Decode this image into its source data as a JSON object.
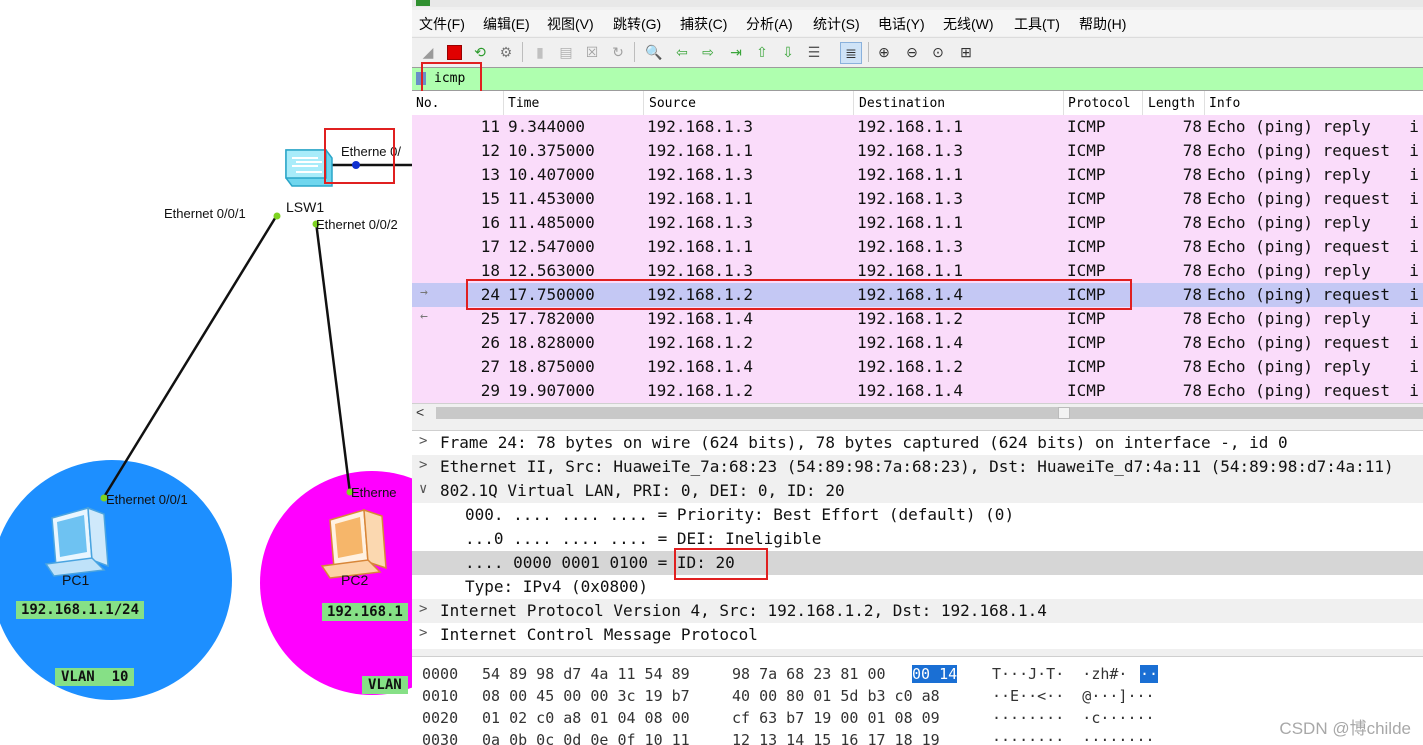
{
  "topology": {
    "switch_label": "LSW1",
    "port_e001": "Ethernet 0/0/1",
    "port_e002": "Ethernet 0/0/2",
    "port_uplink": "Etherne",
    "port_uplink_cut": "0/",
    "pc1": {
      "name": "PC1",
      "port": "Ethernet 0/0/1",
      "ip": "192.168.1.1/24",
      "vlan": "VLAN  10"
    },
    "pc2": {
      "name": "PC2",
      "port": "Etherne",
      "ip": "192.168.1",
      "vlan": "VLAN"
    },
    "colors": {
      "pc1_circle": "#1d8fff",
      "pc2_circle": "#ff00ff",
      "badge": "#86e086",
      "highlight_box": "#e02020"
    }
  },
  "wireshark": {
    "menu": [
      "文件(F)",
      "编辑(E)",
      "视图(V)",
      "跳转(G)",
      "捕获(C)",
      "分析(A)",
      "统计(S)",
      "电话(Y)",
      "无线(W)",
      "工具(T)",
      "帮助(H)"
    ],
    "filter": {
      "value": "icmp"
    },
    "columns": [
      "No.",
      "Time",
      "Source",
      "Destination",
      "Protocol",
      "Length",
      "Info"
    ],
    "packets": [
      {
        "no": "11",
        "time": "9.344000",
        "src": "192.168.1.3",
        "dst": "192.168.1.1",
        "proto": "ICMP",
        "len": "78",
        "info": "Echo (ping) reply    i"
      },
      {
        "no": "12",
        "time": "10.375000",
        "src": "192.168.1.1",
        "dst": "192.168.1.3",
        "proto": "ICMP",
        "len": "78",
        "info": "Echo (ping) request  i"
      },
      {
        "no": "13",
        "time": "10.407000",
        "src": "192.168.1.3",
        "dst": "192.168.1.1",
        "proto": "ICMP",
        "len": "78",
        "info": "Echo (ping) reply    i"
      },
      {
        "no": "15",
        "time": "11.453000",
        "src": "192.168.1.1",
        "dst": "192.168.1.3",
        "proto": "ICMP",
        "len": "78",
        "info": "Echo (ping) request  i"
      },
      {
        "no": "16",
        "time": "11.485000",
        "src": "192.168.1.3",
        "dst": "192.168.1.1",
        "proto": "ICMP",
        "len": "78",
        "info": "Echo (ping) reply    i"
      },
      {
        "no": "17",
        "time": "12.547000",
        "src": "192.168.1.1",
        "dst": "192.168.1.3",
        "proto": "ICMP",
        "len": "78",
        "info": "Echo (ping) request  i"
      },
      {
        "no": "18",
        "time": "12.563000",
        "src": "192.168.1.3",
        "dst": "192.168.1.1",
        "proto": "ICMP",
        "len": "78",
        "info": "Echo (ping) reply    i"
      },
      {
        "no": "24",
        "time": "17.750000",
        "src": "192.168.1.2",
        "dst": "192.168.1.4",
        "proto": "ICMP",
        "len": "78",
        "info": "Echo (ping) request  i"
      },
      {
        "no": "25",
        "time": "17.782000",
        "src": "192.168.1.4",
        "dst": "192.168.1.2",
        "proto": "ICMP",
        "len": "78",
        "info": "Echo (ping) reply    i"
      },
      {
        "no": "26",
        "time": "18.828000",
        "src": "192.168.1.2",
        "dst": "192.168.1.4",
        "proto": "ICMP",
        "len": "78",
        "info": "Echo (ping) request  i"
      },
      {
        "no": "27",
        "time": "18.875000",
        "src": "192.168.1.4",
        "dst": "192.168.1.2",
        "proto": "ICMP",
        "len": "78",
        "info": "Echo (ping) reply    i"
      },
      {
        "no": "29",
        "time": "19.907000",
        "src": "192.168.1.2",
        "dst": "192.168.1.4",
        "proto": "ICMP",
        "len": "78",
        "info": "Echo (ping) request  i"
      }
    ],
    "selected_no": "24",
    "details": [
      {
        "arrow": ">",
        "indent": 0,
        "text": "Frame 24: 78 bytes on wire (624 bits), 78 bytes captured (624 bits) on interface -, id 0"
      },
      {
        "arrow": ">",
        "indent": 0,
        "text": "Ethernet II, Src: HuaweiTe_7a:68:23 (54:89:98:7a:68:23), Dst: HuaweiTe_d7:4a:11 (54:89:98:d7:4a:11)"
      },
      {
        "arrow": "∨",
        "indent": 0,
        "text": "802.1Q Virtual LAN, PRI: 0, DEI: 0, ID: 20"
      },
      {
        "arrow": "",
        "indent": 1,
        "text": "000. .... .... .... = Priority: Best Effort (default) (0)"
      },
      {
        "arrow": "",
        "indent": 1,
        "text": "...0 .... .... .... = DEI: Ineligible"
      },
      {
        "arrow": "",
        "indent": 1,
        "text": ".... 0000 0001 0100 = ID: 20"
      },
      {
        "arrow": "",
        "indent": 1,
        "text": "Type: IPv4 (0x0800)"
      },
      {
        "arrow": ">",
        "indent": 0,
        "text": "Internet Protocol Version 4, Src: 192.168.1.2, Dst: 192.168.1.4"
      },
      {
        "arrow": ">",
        "indent": 0,
        "text": "Internet Control Message Protocol"
      }
    ],
    "hex": [
      {
        "offset": "0000",
        "bytes_a": "54 89 98 d7 4a 11 54 89",
        "bytes_b": "98 7a 68 23 81 00",
        "sel_bytes": "00 14",
        "ascii": "T···J·T·  ·zh#·",
        "ascii_sel": "··"
      },
      {
        "offset": "0010",
        "bytes_a": "08 00 45 00 00 3c 19 b7",
        "bytes_b": "40 00 80 01 5d b3 c0 a8",
        "sel_bytes": "",
        "ascii": "··E··<··  @···]···",
        "ascii_sel": ""
      },
      {
        "offset": "0020",
        "bytes_a": "01 02 c0 a8 01 04 08 00",
        "bytes_b": "cf 63 b7 19 00 01 08 09",
        "sel_bytes": "",
        "ascii": "········  ·c······",
        "ascii_sel": ""
      },
      {
        "offset": "0030",
        "bytes_a": "0a 0b 0c 0d 0e 0f 10 11",
        "bytes_b": "12 13 14 15 16 17 18 19",
        "sel_bytes": "",
        "ascii": "········  ········",
        "ascii_sel": ""
      }
    ],
    "colors": {
      "packet_row": "#fadcfa",
      "selected_row": "#c4c8f4",
      "filter_bg": "#afffaf",
      "hex_selection": "#1a6fd4"
    }
  },
  "watermark": "CSDN @博childe"
}
